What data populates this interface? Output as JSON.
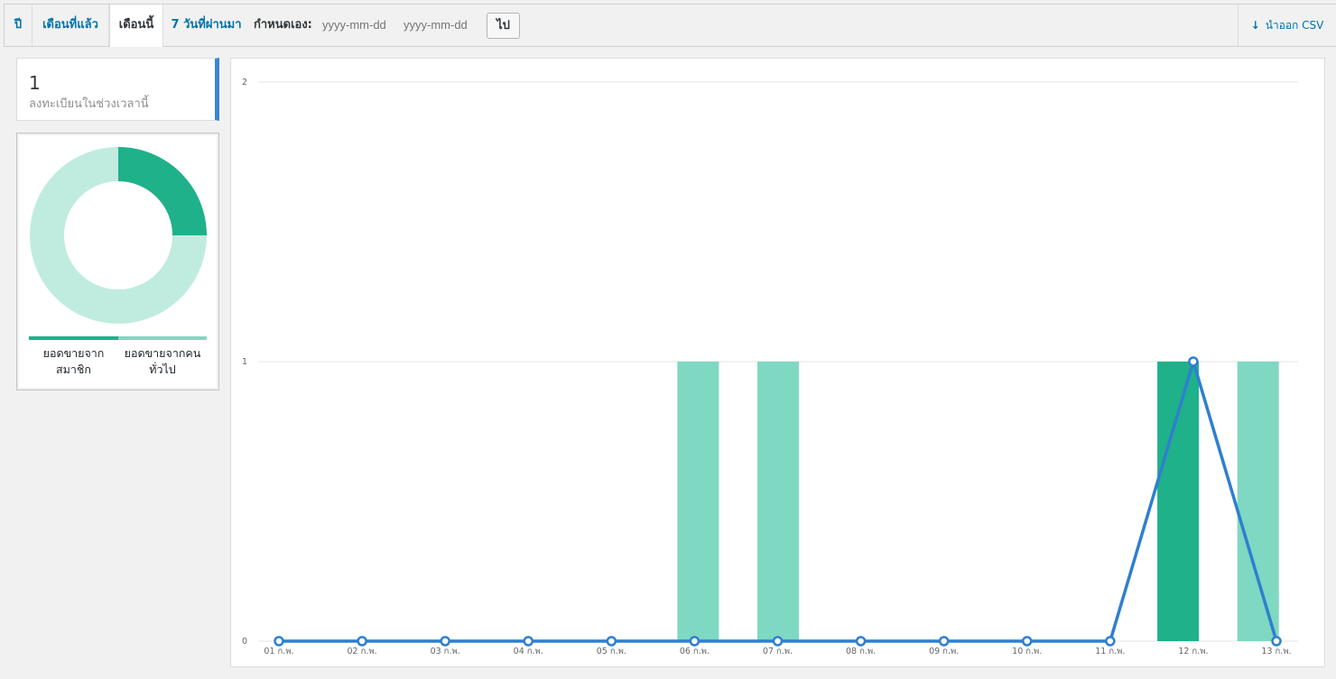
{
  "tabs": [
    {
      "label": "ปี",
      "active": false
    },
    {
      "label": "เดือนที่แล้ว",
      "active": false
    },
    {
      "label": "เดือนนี้",
      "active": true
    },
    {
      "label": "7 วันที่ผ่านมา",
      "active": false
    }
  ],
  "custom_range": {
    "label": "กำหนดเอง:",
    "from_placeholder": "yyyy-mm-dd",
    "to_placeholder": "yyyy-mm-dd",
    "go_label": "ไป"
  },
  "export": {
    "label": "นำออก CSV",
    "icon": "arrow-down-icon"
  },
  "summary": {
    "value": "1",
    "label": "ลงทะเบียนในช่วงเวลานี้",
    "accent": "#3a86cf"
  },
  "pie_legend": [
    {
      "label": "ยอดขายจาก สมาชิก",
      "color": "#1fb18a"
    },
    {
      "label": "ยอดขายจากคน ทั่วไป",
      "color": "#7fd8c2"
    }
  ],
  "chart_data": {
    "type": "bar",
    "categories": [
      "01 ก.พ.",
      "02 ก.พ.",
      "03 ก.พ.",
      "04 ก.พ.",
      "05 ก.พ.",
      "06 ก.พ.",
      "07 ก.พ.",
      "08 ก.พ.",
      "09 ก.พ.",
      "10 ก.พ.",
      "11 ก.พ.",
      "12 ก.พ.",
      "13 ก.พ."
    ],
    "ylim": [
      0,
      2
    ],
    "yticks": [
      0,
      1,
      2
    ],
    "series": [
      {
        "type": "bar",
        "color": "#7fd8c2",
        "values": [
          0,
          0,
          0,
          0,
          0,
          1,
          1,
          0,
          0,
          0,
          0,
          0,
          1
        ]
      },
      {
        "type": "bar",
        "color": "#1fb18a",
        "values": [
          0,
          0,
          0,
          0,
          0,
          0,
          0,
          0,
          0,
          0,
          0,
          1,
          0
        ]
      },
      {
        "type": "line",
        "color": "#2f7fcf",
        "values": [
          0,
          0,
          0,
          0,
          0,
          0,
          0,
          0,
          0,
          0,
          0,
          1,
          0
        ]
      }
    ],
    "grid": true
  },
  "donut_data": {
    "type": "pie",
    "values": [
      25,
      75
    ],
    "colors": [
      "#1fb18a",
      "#c0ece0"
    ]
  }
}
